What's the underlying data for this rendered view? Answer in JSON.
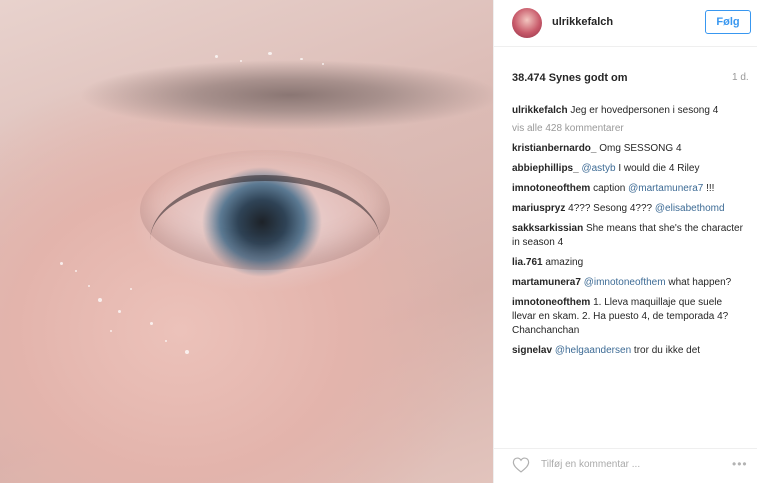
{
  "post": {
    "username": "ulrikkefalch",
    "follow_label": "Følg",
    "likes": "38.474 Synes godt om",
    "age": "1 d.",
    "caption_user": "ulrikkefalch",
    "caption_text": "Jeg er hovedpersonen i sesong 4",
    "view_all": "vis alle 428 kommentarer",
    "add_comment_placeholder": "Tilføj en kommentar ...",
    "more_glyph": "•••"
  },
  "comments": [
    {
      "user": "kristianbernardo_",
      "text": "Omg SESSONG 4"
    },
    {
      "user": "abbiephillips_",
      "mention": "@astyb",
      "text": "I would die 4 Riley"
    },
    {
      "user": "imnotoneofthem",
      "text": "caption",
      "mention": "@martamunera7",
      "tail": "!!!"
    },
    {
      "user": "mariuspryz",
      "text": "4??? Sesong 4???",
      "mention": "@elisabethomd"
    },
    {
      "user": "sakksarkissian",
      "text": "She means that she's the character in season 4"
    },
    {
      "user": "lia.761",
      "text": "amazing"
    },
    {
      "user": "martamunera7",
      "mention": "@imnotoneofthem",
      "text": "what happen?"
    },
    {
      "user": "imnotoneofthem",
      "text": "1. Lleva maquillaje que suele llevar en skam. 2. Ha puesto 4, de temporada 4? Chanchanchan"
    },
    {
      "user": "signelav",
      "mention": "@helgaandersen",
      "text": "tror du ikke det"
    }
  ]
}
